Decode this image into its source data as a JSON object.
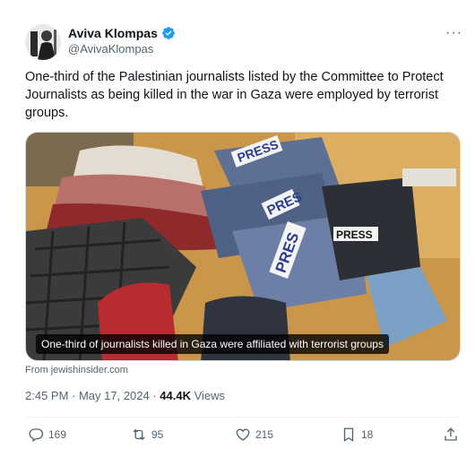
{
  "author": {
    "display_name": "Aviva Klompas",
    "handle": "@AvivaKlompas",
    "verified_icon": "verified-badge-icon",
    "avatar_icon": "avatar"
  },
  "tweet": {
    "text": "One-third of the Palestinian journalists listed by the Committee to Protect Journalists as being killed in the war in Gaza were employed by terrorist groups."
  },
  "media": {
    "caption": "One-third of journalists killed in Gaza were affiliated with terrorist groups",
    "source": "From jewishinsider.com",
    "vest_labels": [
      "PRESS",
      "PRES",
      "PRES",
      "PRESS"
    ]
  },
  "meta": {
    "timestamp": "2:45 PM · May 17, 2024 · ",
    "views_count": "44.4K",
    "views_label": " Views"
  },
  "actions": {
    "reply_count": "169",
    "repost_count": "95",
    "like_count": "215",
    "bookmark_count": "18"
  },
  "colors": {
    "text": "#0f1419",
    "secondary": "#536471",
    "verified": "#1d9bf0",
    "divider": "#eff3f4"
  }
}
